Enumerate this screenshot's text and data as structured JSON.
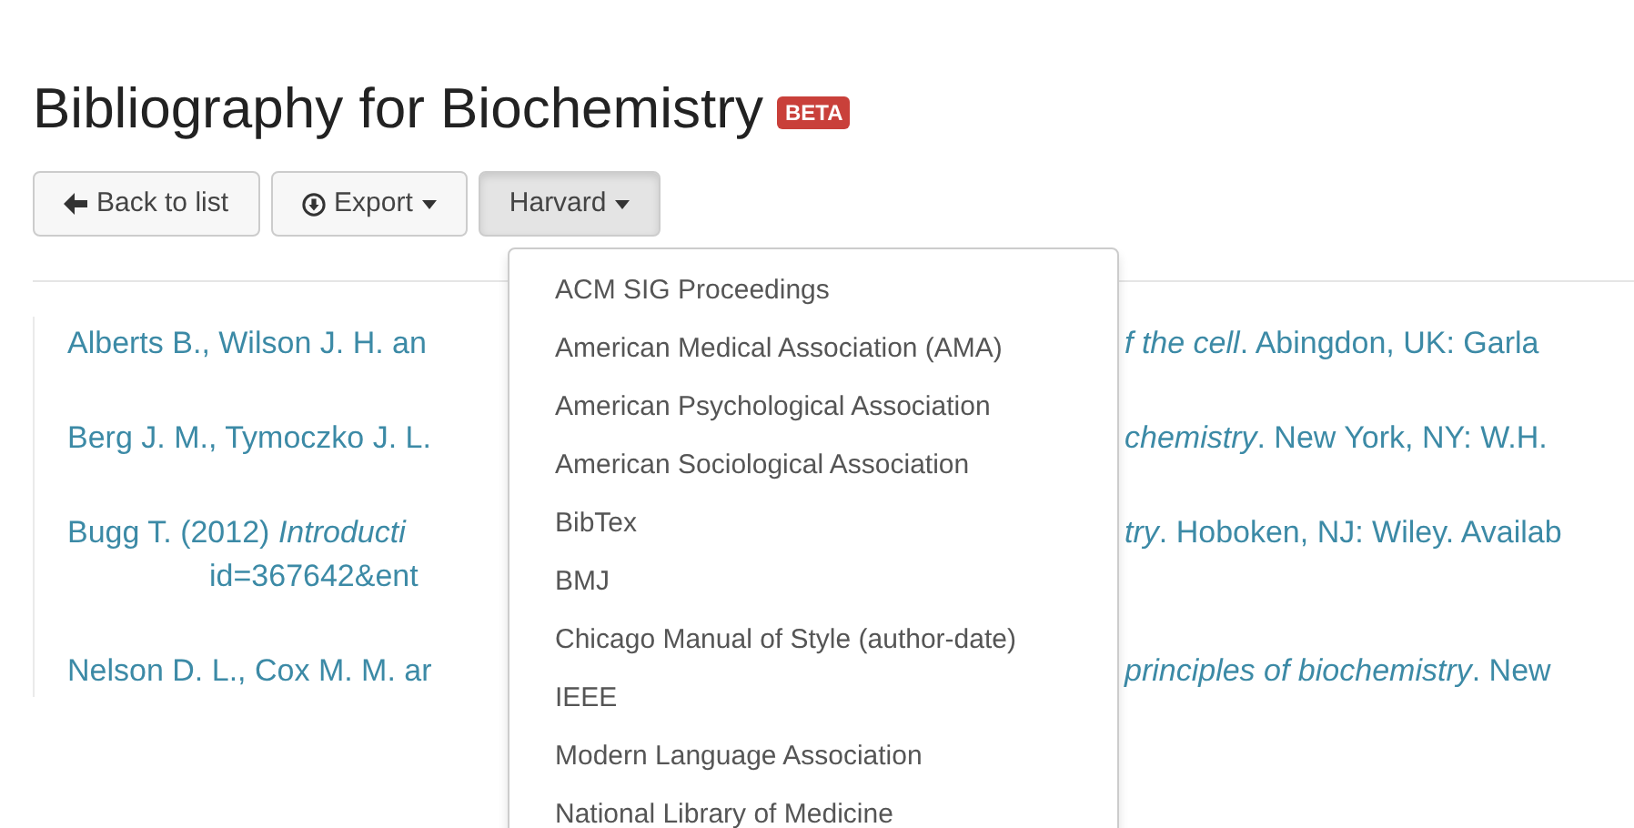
{
  "title": "Bibliography for Biochemistry",
  "badge": "BETA",
  "toolbar": [
    {
      "label": "Back to list",
      "kind": "back",
      "caret": false,
      "selected": false
    },
    {
      "label": "Export",
      "kind": "export",
      "caret": true,
      "selected": false
    },
    {
      "label": "Harvard",
      "kind": "style",
      "caret": true,
      "selected": true
    }
  ],
  "references": [
    {
      "left": [
        "Alberts B., Wilson J. H. an"
      ],
      "right": "*f the cell*. Abingdon, UK: Garla"
    },
    {
      "left": [
        "Berg J. M., Tymoczko J. L."
      ],
      "right": "*chemistry*. New York, NY: W.H."
    },
    {
      "left": [
        "Bugg T. (2012) *Introducti*",
        "id=367642&ent"
      ],
      "right": "*try*. Hoboken, NJ: Wiley. Availab"
    },
    {
      "left": [
        "Nelson D. L., Cox M. M. ar"
      ],
      "right": "*principles of biochemistry*. New"
    }
  ],
  "style_menu": [
    "ACM SIG Proceedings",
    "American Medical Association (AMA)",
    "American Psychological Association",
    "American Sociological Association",
    "BibTex",
    "BMJ",
    "Chicago Manual of Style (author-date)",
    "IEEE",
    "Modern Language Association",
    "National Library of Medicine"
  ]
}
